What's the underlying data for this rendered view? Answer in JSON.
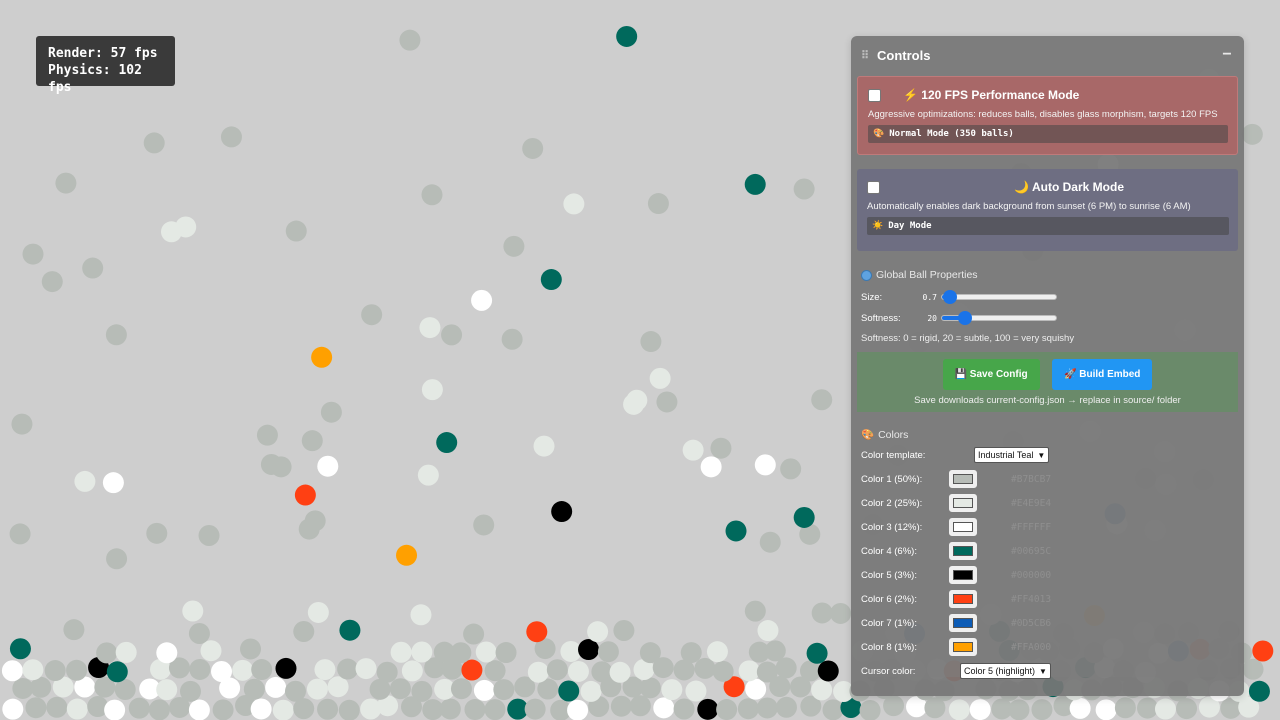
{
  "fps": {
    "render_label": "Render:",
    "render_value": "57 fps",
    "physics_label": "Physics:",
    "physics_value": "102 fps"
  },
  "panel": {
    "title": "Controls",
    "perf": {
      "icon": "⚡",
      "title": "120 FPS Performance Mode",
      "description": "Aggressive optimizations: reduces balls, disables glass morphism, targets 120 FPS",
      "status_icon": "🎨",
      "status": "Normal Mode (350 balls)",
      "checked": false
    },
    "dark": {
      "icon": "🌙",
      "title": "Auto Dark Mode",
      "description": "Automatically enables dark background from sunset (6 PM) to sunrise (6 AM)",
      "status_icon": "☀️",
      "status": "Day Mode",
      "checked": false
    },
    "global": {
      "title": "Global Ball Properties",
      "size_label": "Size:",
      "size_value": "0.7",
      "size_fraction": 0.07,
      "softness_label": "Softness:",
      "softness_value": "20",
      "softness_fraction": 0.2,
      "hint": "Softness: 0 = rigid, 20 = subtle, 100 = very squishy"
    },
    "save": {
      "save_label": "💾 Save Config",
      "build_label": "🚀 Build Embed",
      "note": "Save downloads current-config.json → replace in source/ folder"
    },
    "colors": {
      "title_icon": "🎨",
      "title": "Colors",
      "template_label": "Color template:",
      "template_value": "Industrial Teal",
      "items": [
        {
          "label": "Color 1 (50%):",
          "hex": "#B7BCB7",
          "color": "#b7bcb7"
        },
        {
          "label": "Color 2 (25%):",
          "hex": "#E4E9E4",
          "color": "#e4e9e4"
        },
        {
          "label": "Color 3 (12%):",
          "hex": "#FFFFFF",
          "color": "#ffffff"
        },
        {
          "label": "Color 4 (6%):",
          "hex": "#00695C",
          "color": "#00695c"
        },
        {
          "label": "Color 5 (3%):",
          "hex": "#000000",
          "color": "#000000"
        },
        {
          "label": "Color 6 (2%):",
          "hex": "#FF4013",
          "color": "#ff4013"
        },
        {
          "label": "Color 7 (1%):",
          "hex": "#0D5CB6",
          "color": "#0d5cb6"
        },
        {
          "label": "Color 8 (1%):",
          "hex": "#FFA000",
          "color": "#ffa000"
        }
      ],
      "cursor_label": "Cursor color:",
      "cursor_value": "Color 5 (highlight)"
    }
  }
}
